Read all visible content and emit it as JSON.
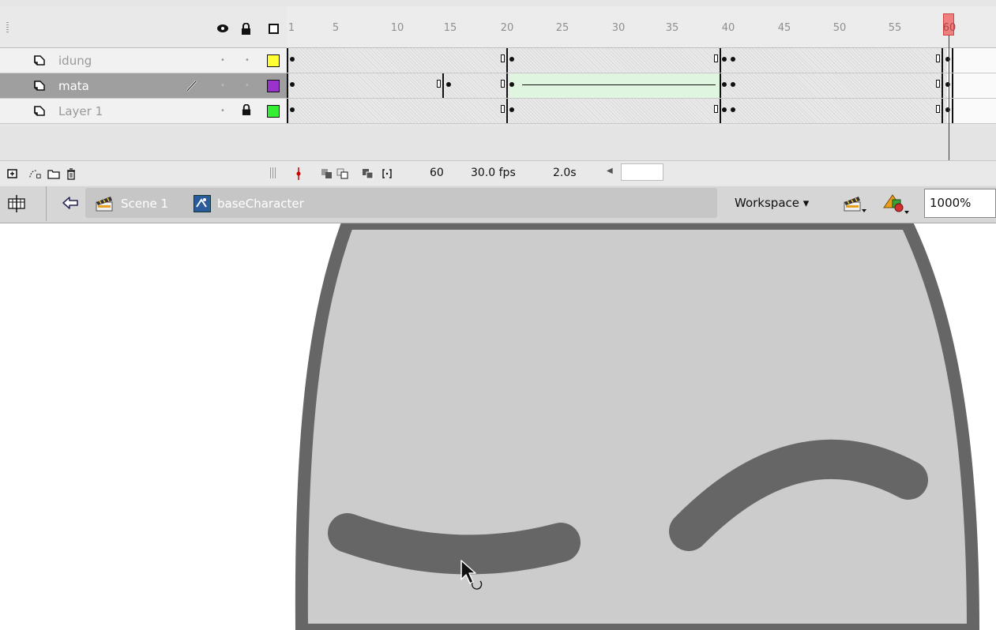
{
  "timeline": {
    "ruler_numbers": [
      "1",
      "5",
      "10",
      "15",
      "20",
      "25",
      "30",
      "35",
      "40",
      "45",
      "50",
      "55",
      "60"
    ],
    "layers": [
      {
        "name": "idung",
        "color": "#ffff33",
        "selected": false
      },
      {
        "name": "mata",
        "color": "#9933cc",
        "selected": true
      },
      {
        "name": "Layer 1",
        "color": "#33ee33",
        "selected": false
      }
    ],
    "status": {
      "current_frame": "60",
      "fps": "30.0 fps",
      "elapsed": "2.0s"
    }
  },
  "edit_bar": {
    "scene_label": "Scene 1",
    "symbol_label": "baseCharacter",
    "workspace_label": "Workspace ▾",
    "zoom": "1000%"
  },
  "icons": {
    "eye": "eye-icon",
    "lock": "lock-icon",
    "outline": "outline-icon",
    "layer": "layer-icon",
    "pencil": "pencil-icon",
    "back": "back-arrow-icon",
    "scene": "scene-clapper-icon",
    "symbol": "movieclip-symbol-icon",
    "edit_scene": "edit-scene-icon",
    "edit_symbol": "edit-symbol-icon",
    "cursor": "arrow-cursor-icon"
  },
  "colors": {
    "stage_fill": "#cccccc",
    "stroke": "#666666",
    "playhead": "#cc0000"
  }
}
